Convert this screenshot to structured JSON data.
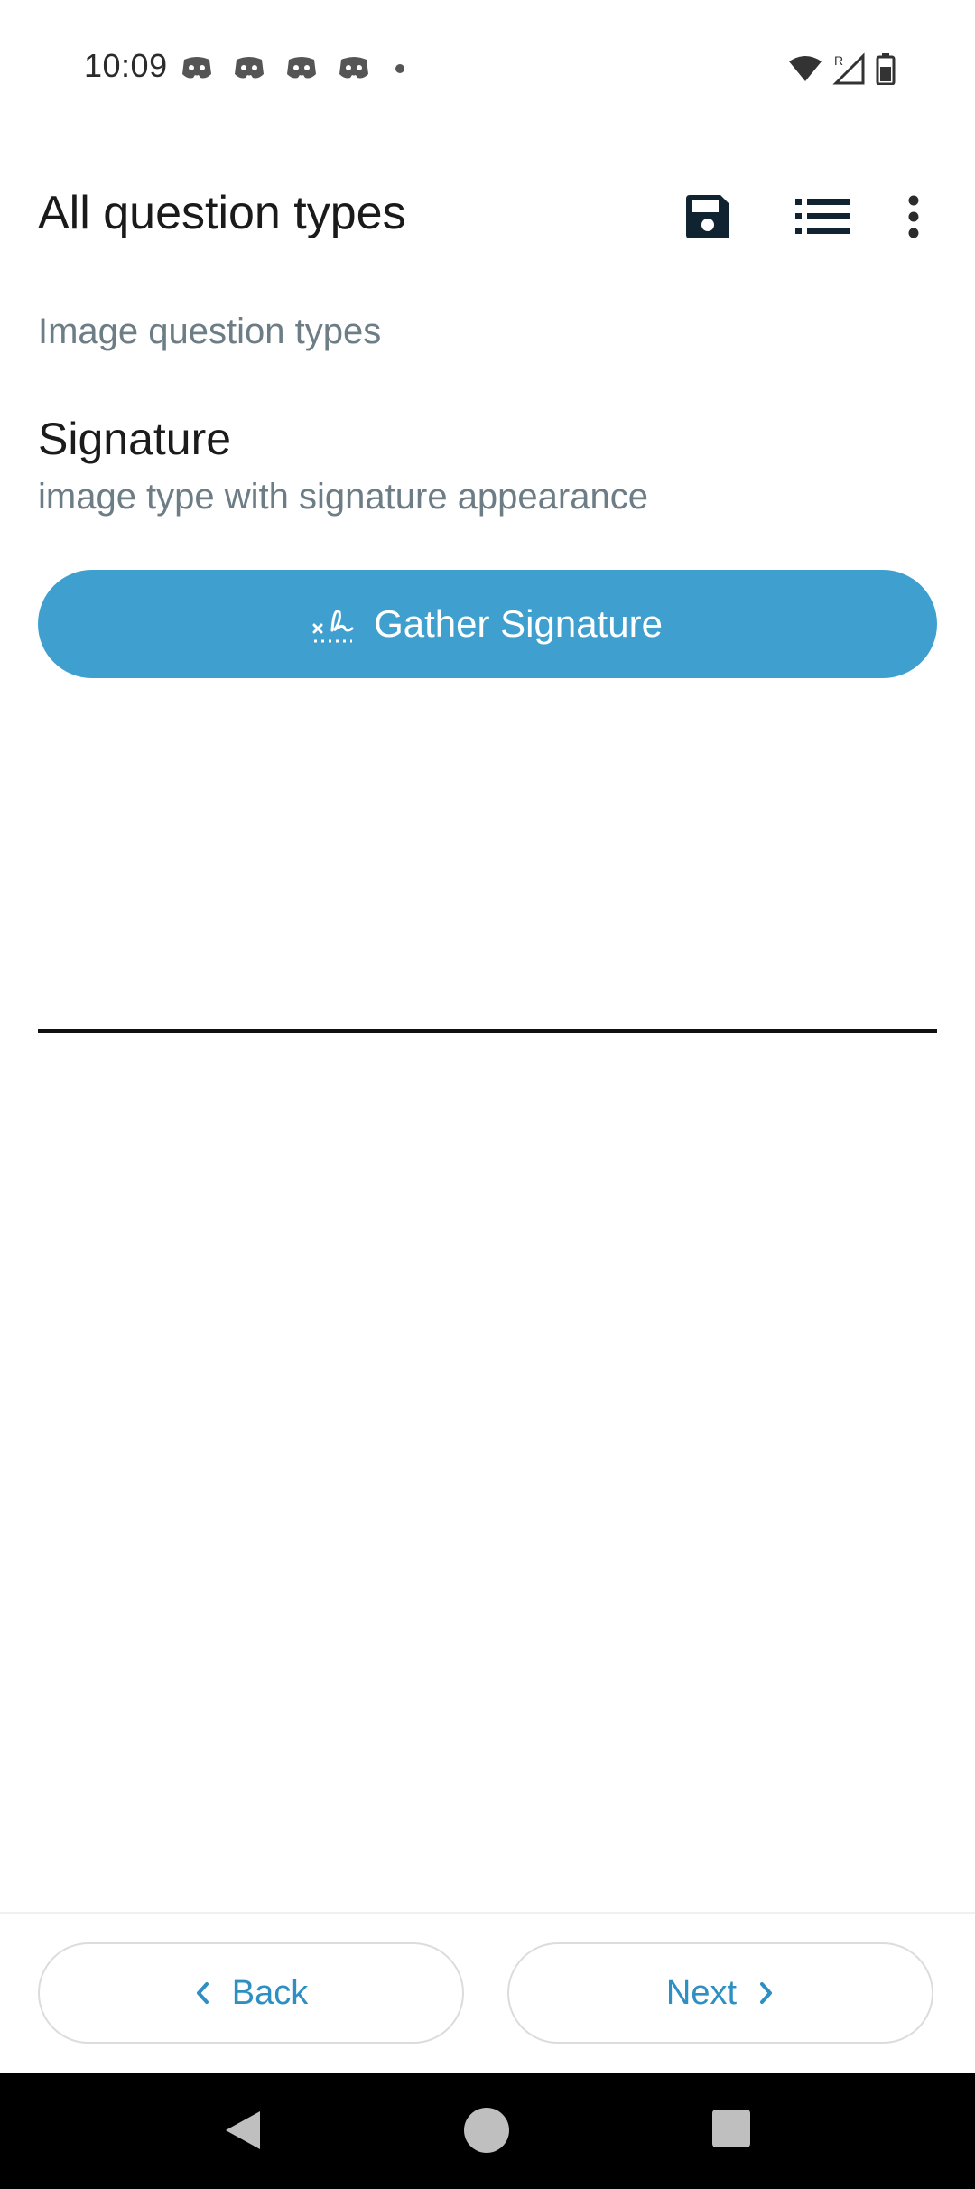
{
  "status_bar": {
    "time": "10:09",
    "notification_icons": [
      "discord-icon",
      "discord-icon",
      "discord-icon",
      "discord-icon"
    ],
    "system_icons": [
      "wifi-icon",
      "signal-roaming-icon",
      "battery-icon"
    ]
  },
  "toolbar": {
    "title": "All question types",
    "actions": [
      "save-icon",
      "list-icon",
      "more-vert-icon"
    ]
  },
  "content": {
    "group_label": "Image question types",
    "question_title": "Signature",
    "question_hint": "image type with signature appearance",
    "gather_button_label": "Gather Signature"
  },
  "navigation": {
    "back_label": "Back",
    "next_label": "Next"
  },
  "colors": {
    "accent": "#3fa0cf",
    "nav_text": "#2e8fc2",
    "muted_text": "#6c7d86",
    "icon_dark": "#0f2330"
  }
}
